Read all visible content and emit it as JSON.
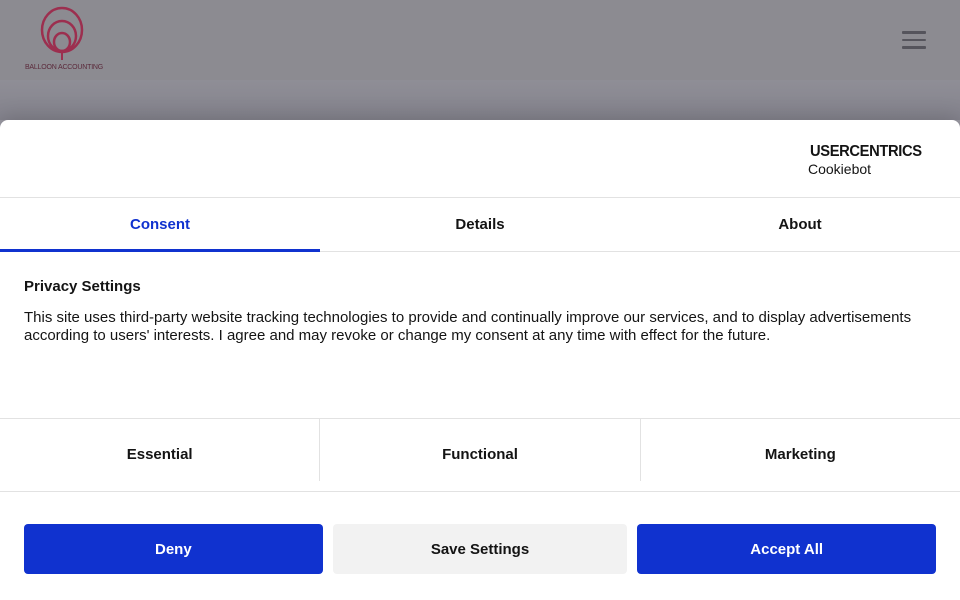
{
  "site": {
    "logo_text": "BALLOON ACCOUNTING",
    "menu_icon": "hamburger-menu-icon"
  },
  "dialog": {
    "brand": {
      "name": "USERCENTRICS",
      "sub": "Cookiebot",
      "icon": "shield-check-icon"
    },
    "tabs": [
      {
        "label": "Consent",
        "active": true
      },
      {
        "label": "Details",
        "active": false
      },
      {
        "label": "About",
        "active": false
      }
    ],
    "heading": "Privacy Settings",
    "body": "This site uses third-party website tracking technologies to provide and continually improve our services, and to display advertisements according to users' interests. I agree and may revoke or change my consent at any time with effect for the future.",
    "categories": [
      "Essential",
      "Functional",
      "Marketing"
    ],
    "buttons": {
      "deny": "Deny",
      "save": "Save Settings",
      "accept": "Accept All"
    }
  },
  "colors": {
    "accent": "#1032cf",
    "overlay": "#9b9aa3",
    "logo": "#a3254f"
  }
}
